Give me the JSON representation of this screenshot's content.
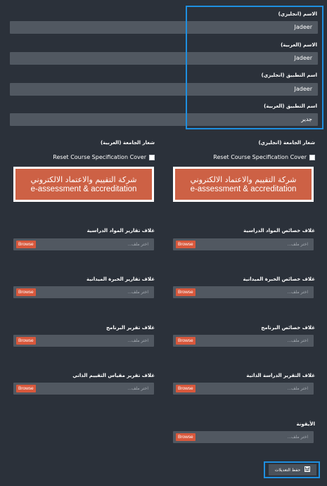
{
  "general": {
    "name_en_label": "الاسم (انجليزي)",
    "name_en_value": "Jadeer",
    "name_ar_label": "الاسم (العربية)",
    "name_ar_value": "Jadeer",
    "app_name_en_label": "اسم التطبيق (انجليزي)",
    "app_name_en_value": "Jadeer",
    "app_name_ar_label": "اسم التطبيق (العربية)",
    "app_name_ar_value": "جدير"
  },
  "logos": {
    "en_label": "شعار الجامعة (انجليزي)",
    "ar_label": "شعار الجامعة (العربية)",
    "reset_label": "Reset Course Specification Cover",
    "banner_ar_text": "شركة التقييم والاعتماد الالكتروني",
    "banner_en_text": "e-assessment & accreditation"
  },
  "uploads": {
    "browse_label": "Browse",
    "placeholder": "اختر ملف...",
    "items": [
      {
        "label": "غلاف خصائص المواد الدراسية"
      },
      {
        "label": "غلاف تقارير المواد الدراسية"
      },
      {
        "label": "غلاف خصائص الخبرة الميدانية"
      },
      {
        "label": "غلاف تقارير الخبرة الميدانية"
      },
      {
        "label": "غلاف خصائص البرنامج"
      },
      {
        "label": "غلاف تقرير البرنامج"
      },
      {
        "label": "غلاف التقرير الدراسة الذاتية"
      },
      {
        "label": "غلاف تقرير مقياس التقييم الذاتي"
      },
      {
        "label": "الأيقونة"
      }
    ]
  },
  "actions": {
    "save_label": "حفظ التعديلات",
    "save_icon": "floppy-disk-icon",
    "highlight_color": "#1e8fe0",
    "browse_color": "#d8583c"
  }
}
